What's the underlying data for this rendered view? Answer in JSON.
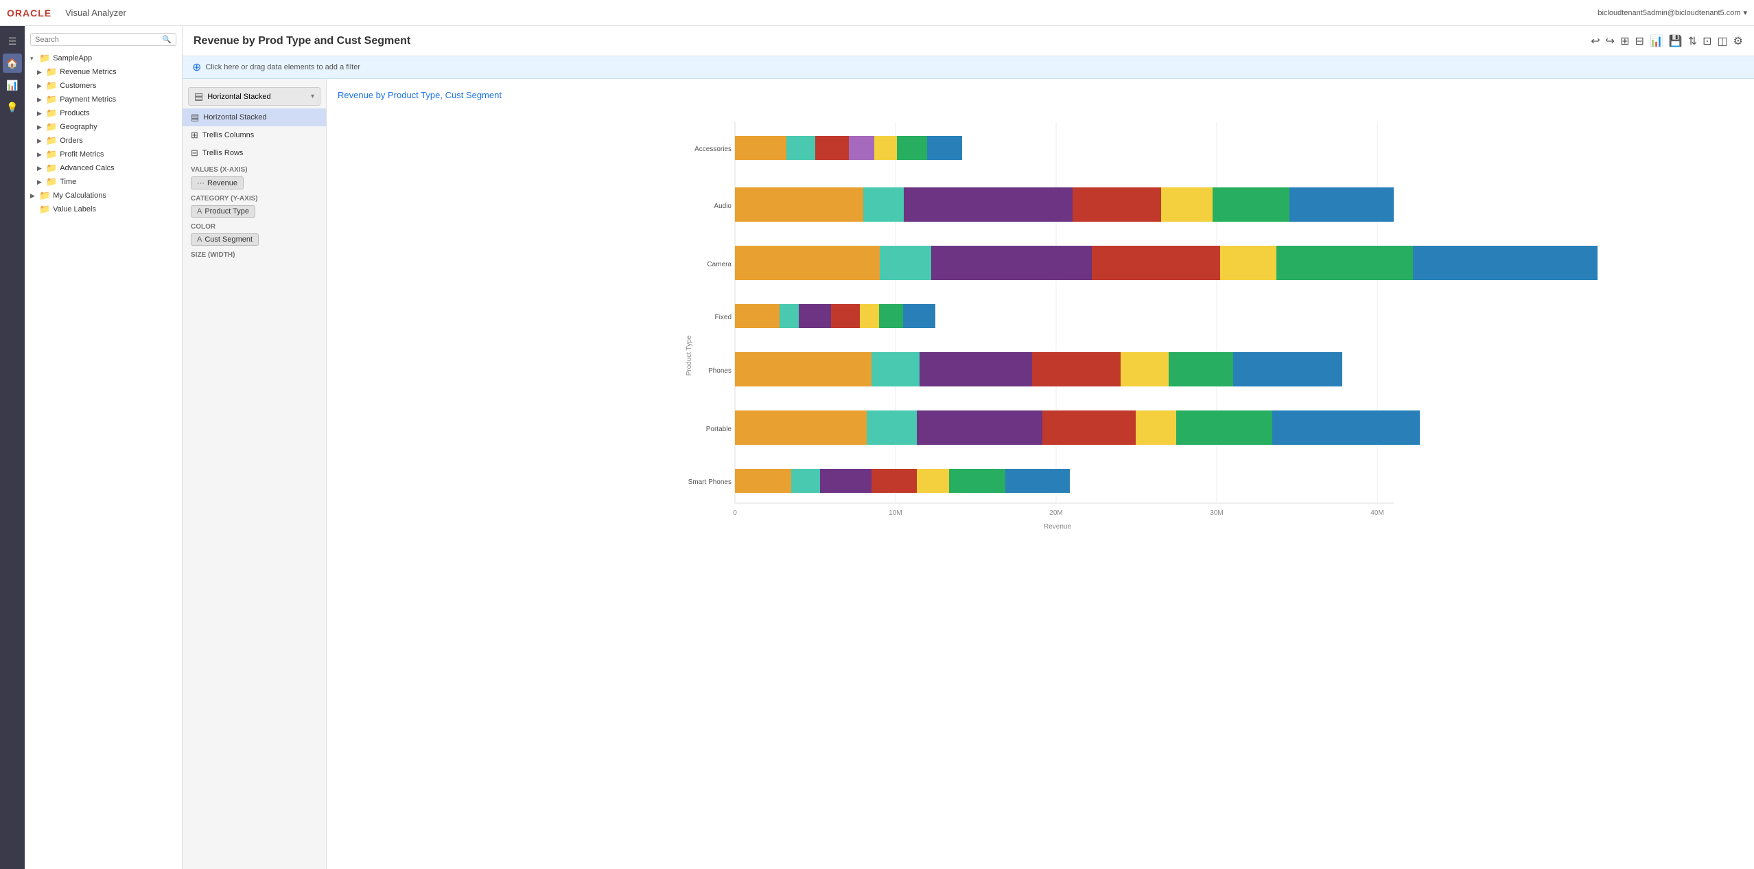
{
  "topbar": {
    "oracle_text": "ORACLE",
    "app_name": "Visual Analyzer",
    "user_email": "bicloudtenant5admin@bicloudtenant5.com",
    "search_placeholder": "Search"
  },
  "page": {
    "title": "Revenue by Prod Type and Cust Segment"
  },
  "filter_bar": {
    "placeholder": "Click here or drag data elements to add a filter"
  },
  "sidebar": {
    "root": "SampleApp",
    "items": [
      {
        "label": "Revenue Metrics",
        "indent": 1,
        "has_arrow": true
      },
      {
        "label": "Customers",
        "indent": 1,
        "has_arrow": true
      },
      {
        "label": "Payment Metrics",
        "indent": 1,
        "has_arrow": true
      },
      {
        "label": "Products",
        "indent": 1,
        "has_arrow": true
      },
      {
        "label": "Geography",
        "indent": 1,
        "has_arrow": true
      },
      {
        "label": "Orders",
        "indent": 1,
        "has_arrow": true
      },
      {
        "label": "Profit Metrics",
        "indent": 1,
        "has_arrow": true
      },
      {
        "label": "Advanced Calcs",
        "indent": 1,
        "has_arrow": true
      },
      {
        "label": "Time",
        "indent": 1,
        "has_arrow": true
      },
      {
        "label": "My Calculations",
        "indent": 0,
        "has_arrow": true
      },
      {
        "label": "Value Labels",
        "indent": 0,
        "has_arrow": false
      }
    ]
  },
  "chart_config": {
    "current_type": "Horizontal Stacked",
    "menu_items": [
      {
        "label": "Horizontal Stacked",
        "icon": "▤"
      },
      {
        "label": "Trellis Columns",
        "icon": "⊞"
      },
      {
        "label": "Trellis Rows",
        "icon": "⊟"
      }
    ],
    "values_x_axis_label": "Values (X-Axis)",
    "values_tag": "Revenue",
    "category_y_axis_label": "Category (Y-Axis)",
    "category_tag": "Product Type",
    "color_label": "Color",
    "color_tag": "Cust Segment",
    "size_label": "Size (Width)"
  },
  "chart": {
    "title": "Revenue by Product Type, Cust Segment",
    "x_axis_label": "Revenue",
    "y_axis_label": "Product Type",
    "x_ticks": [
      "0",
      "10M",
      "20M",
      "30M",
      "40M"
    ],
    "bars": [
      {
        "category": "Accessories",
        "segments": [
          {
            "color": "#e8a030",
            "width": 3.2
          },
          {
            "color": "#48c9b0",
            "width": 1.8
          },
          {
            "color": "#c0392b",
            "width": 2.1
          },
          {
            "color": "#a569bd",
            "width": 1.6
          },
          {
            "color": "#f4d03f",
            "width": 1.4
          },
          {
            "color": "#27ae60",
            "width": 1.9
          },
          {
            "color": "#2980b9",
            "width": 2.2
          }
        ]
      },
      {
        "category": "Audio",
        "segments": [
          {
            "color": "#e8a030",
            "width": 8.0
          },
          {
            "color": "#48c9b0",
            "width": 2.5
          },
          {
            "color": "#6c3483",
            "width": 10.5
          },
          {
            "color": "#c0392b",
            "width": 5.5
          },
          {
            "color": "#f4d03f",
            "width": 3.2
          },
          {
            "color": "#27ae60",
            "width": 4.8
          },
          {
            "color": "#2980b9",
            "width": 6.5
          }
        ]
      },
      {
        "category": "Camera",
        "segments": [
          {
            "color": "#e8a030",
            "width": 9.0
          },
          {
            "color": "#48c9b0",
            "width": 3.2
          },
          {
            "color": "#6c3483",
            "width": 10.0
          },
          {
            "color": "#c0392b",
            "width": 8.0
          },
          {
            "color": "#f4d03f",
            "width": 3.5
          },
          {
            "color": "#27ae60",
            "width": 8.5
          },
          {
            "color": "#2980b9",
            "width": 11.5
          }
        ]
      },
      {
        "category": "Fixed",
        "segments": [
          {
            "color": "#e8a030",
            "width": 2.8
          },
          {
            "color": "#48c9b0",
            "width": 1.2
          },
          {
            "color": "#6c3483",
            "width": 2.0
          },
          {
            "color": "#c0392b",
            "width": 1.8
          },
          {
            "color": "#f4d03f",
            "width": 1.2
          },
          {
            "color": "#27ae60",
            "width": 1.5
          },
          {
            "color": "#2980b9",
            "width": 2.0
          }
        ]
      },
      {
        "category": "Phones",
        "segments": [
          {
            "color": "#e8a030",
            "width": 8.5
          },
          {
            "color": "#48c9b0",
            "width": 3.0
          },
          {
            "color": "#6c3483",
            "width": 7.0
          },
          {
            "color": "#c0392b",
            "width": 5.5
          },
          {
            "color": "#f4d03f",
            "width": 3.0
          },
          {
            "color": "#27ae60",
            "width": 4.0
          },
          {
            "color": "#2980b9",
            "width": 6.8
          }
        ]
      },
      {
        "category": "Portable",
        "segments": [
          {
            "color": "#e8a030",
            "width": 8.2
          },
          {
            "color": "#48c9b0",
            "width": 3.1
          },
          {
            "color": "#6c3483",
            "width": 7.8
          },
          {
            "color": "#c0392b",
            "width": 5.8
          },
          {
            "color": "#f4d03f",
            "width": 2.5
          },
          {
            "color": "#27ae60",
            "width": 6.0
          },
          {
            "color": "#2980b9",
            "width": 9.2
          }
        ]
      },
      {
        "category": "Smart Phones",
        "segments": [
          {
            "color": "#e8a030",
            "width": 3.5
          },
          {
            "color": "#48c9b0",
            "width": 1.8
          },
          {
            "color": "#6c3483",
            "width": 3.2
          },
          {
            "color": "#c0392b",
            "width": 2.8
          },
          {
            "color": "#f4d03f",
            "width": 2.0
          },
          {
            "color": "#27ae60",
            "width": 3.5
          },
          {
            "color": "#2980b9",
            "width": 4.0
          }
        ]
      }
    ]
  },
  "toolbar": {
    "undo_label": "↩",
    "redo_label": "↪",
    "icon1": "⊞",
    "icon2": "⊟",
    "icon3": "📊",
    "icon4": "💾",
    "icon5": "⇅",
    "icon6": "⊡",
    "icon7": "◫",
    "icon8": "⚙"
  }
}
